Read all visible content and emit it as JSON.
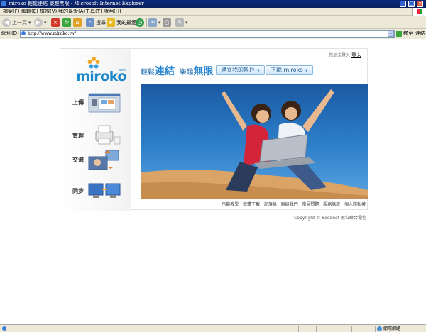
{
  "window": {
    "title": "miroko 輕鬆連結 樂趣無限 - Microsoft Internet Explorer",
    "minimize": "_",
    "maximize": "□",
    "close": "×"
  },
  "menu": {
    "items": [
      "檔案(F)",
      "編輯(E)",
      "檢視(V)",
      "我的最愛(A)",
      "工具(T)",
      "說明(H)"
    ]
  },
  "toolbar": {
    "back_label": "上一頁",
    "search_label": "搜尋",
    "favorites_label": "我的最愛"
  },
  "address": {
    "label": "網址(D)",
    "url": "http://www.miroko.tw/",
    "go_label": "移至",
    "links_label": "連結"
  },
  "page": {
    "logo_text": "miroko",
    "logo_beta": "beta",
    "slogan": {
      "part1": "輕鬆",
      "part2": "連結",
      "part3": "樂趣",
      "part4": "無限"
    },
    "buttons": {
      "create_account": "建立我的帳戶",
      "download": "下載 miroko"
    },
    "login": {
      "status": "您尚未登入",
      "link": "登入"
    },
    "features": [
      {
        "label": "上傳"
      },
      {
        "label": "管理"
      },
      {
        "label": "交流"
      },
      {
        "label": "同步"
      }
    ],
    "footer_links": [
      "示範教學",
      "軟體下載",
      "部落格",
      "聯絡我們",
      "常見問題",
      "服務條款",
      "個人隱私權"
    ],
    "footer_sep": "‧",
    "copyright": "Copyright © Seednet 數位聯合電信"
  },
  "status": {
    "zone": "網際網路"
  },
  "colors": {
    "brand": "#1c88c9",
    "sky": "#2e80cb",
    "sand": "#d9a466"
  }
}
